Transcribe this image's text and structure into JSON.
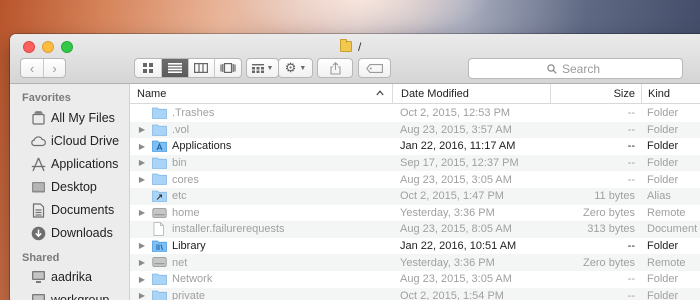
{
  "window": {
    "title": "/",
    "search_placeholder": "Search"
  },
  "toolbar": {
    "back_icon": "chevron-left-icon",
    "forward_icon": "chevron-right-icon",
    "view_modes": [
      "icon-view",
      "list-view",
      "column-view",
      "cover-flow-view"
    ],
    "active_view": "list-view"
  },
  "sidebar": {
    "favorites_heading": "Favorites",
    "favorites": [
      {
        "label": "All My Files",
        "icon": "all-files-icon"
      },
      {
        "label": "iCloud Drive",
        "icon": "cloud-icon"
      },
      {
        "label": "Applications",
        "icon": "applications-icon"
      },
      {
        "label": "Desktop",
        "icon": "desktop-icon"
      },
      {
        "label": "Documents",
        "icon": "documents-icon"
      },
      {
        "label": "Downloads",
        "icon": "downloads-icon"
      }
    ],
    "shared_heading": "Shared",
    "shared": [
      {
        "label": "aadrika",
        "icon": "computer-icon"
      },
      {
        "label": "workgroup",
        "icon": "computer-icon"
      }
    ]
  },
  "columns": {
    "name": "Name",
    "date": "Date Modified",
    "size": "Size",
    "kind": "Kind"
  },
  "files": [
    {
      "name": ".Trashes",
      "date": "Oct 2, 2015, 12:53 PM",
      "size": "--",
      "kind": "Folder",
      "icon": "folder",
      "disclosure": false,
      "bold": false
    },
    {
      "name": ".vol",
      "date": "Aug 23, 2015, 3:57 AM",
      "size": "--",
      "kind": "Folder",
      "icon": "folder",
      "disclosure": true,
      "bold": false
    },
    {
      "name": "Applications",
      "date": "Jan 22, 2016, 11:17 AM",
      "size": "--",
      "kind": "Folder",
      "icon": "app-folder",
      "disclosure": true,
      "bold": true
    },
    {
      "name": "bin",
      "date": "Sep 17, 2015, 12:37 PM",
      "size": "--",
      "kind": "Folder",
      "icon": "folder",
      "disclosure": true,
      "bold": false
    },
    {
      "name": "cores",
      "date": "Aug 23, 2015, 3:05 AM",
      "size": "--",
      "kind": "Folder",
      "icon": "folder",
      "disclosure": true,
      "bold": false
    },
    {
      "name": "etc",
      "date": "Oct 2, 2015, 1:47 PM",
      "size": "11 bytes",
      "kind": "Alias",
      "icon": "alias",
      "disclosure": false,
      "bold": false
    },
    {
      "name": "home",
      "date": "Yesterday, 3:36 PM",
      "size": "Zero bytes",
      "kind": "Remote",
      "icon": "drive",
      "disclosure": true,
      "bold": false
    },
    {
      "name": "installer.failurerequests",
      "date": "Aug 23, 2015, 8:05 AM",
      "size": "313 bytes",
      "kind": "Document",
      "icon": "document",
      "disclosure": false,
      "bold": false
    },
    {
      "name": "Library",
      "date": "Jan 22, 2016, 10:51 AM",
      "size": "--",
      "kind": "Folder",
      "icon": "lib-folder",
      "disclosure": true,
      "bold": true
    },
    {
      "name": "net",
      "date": "Yesterday, 3:36 PM",
      "size": "Zero bytes",
      "kind": "Remote",
      "icon": "drive",
      "disclosure": true,
      "bold": false
    },
    {
      "name": "Network",
      "date": "Aug 23, 2015, 3:05 AM",
      "size": "--",
      "kind": "Folder",
      "icon": "folder",
      "disclosure": true,
      "bold": false
    },
    {
      "name": "private",
      "date": "Oct 2, 2015, 1:54 PM",
      "size": "--",
      "kind": "Folder",
      "icon": "folder",
      "disclosure": true,
      "bold": false
    }
  ]
}
